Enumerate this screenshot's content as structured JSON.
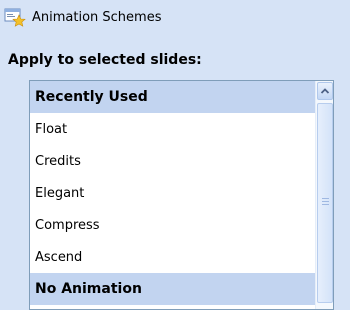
{
  "header": {
    "icon": "animation-schemes-icon",
    "title": "Animation Schemes"
  },
  "section": {
    "label": "Apply to selected slides:"
  },
  "list": {
    "items": [
      {
        "label": "Recently Used",
        "type": "group"
      },
      {
        "label": "Float",
        "type": "item"
      },
      {
        "label": "Credits",
        "type": "item"
      },
      {
        "label": "Elegant",
        "type": "item"
      },
      {
        "label": "Compress",
        "type": "item"
      },
      {
        "label": "Ascend",
        "type": "item"
      },
      {
        "label": "No Animation",
        "type": "group"
      }
    ]
  },
  "colors": {
    "panel_bg": "#d6e3f6",
    "group_bg": "#c2d4f0",
    "list_border": "#7f9db9"
  }
}
